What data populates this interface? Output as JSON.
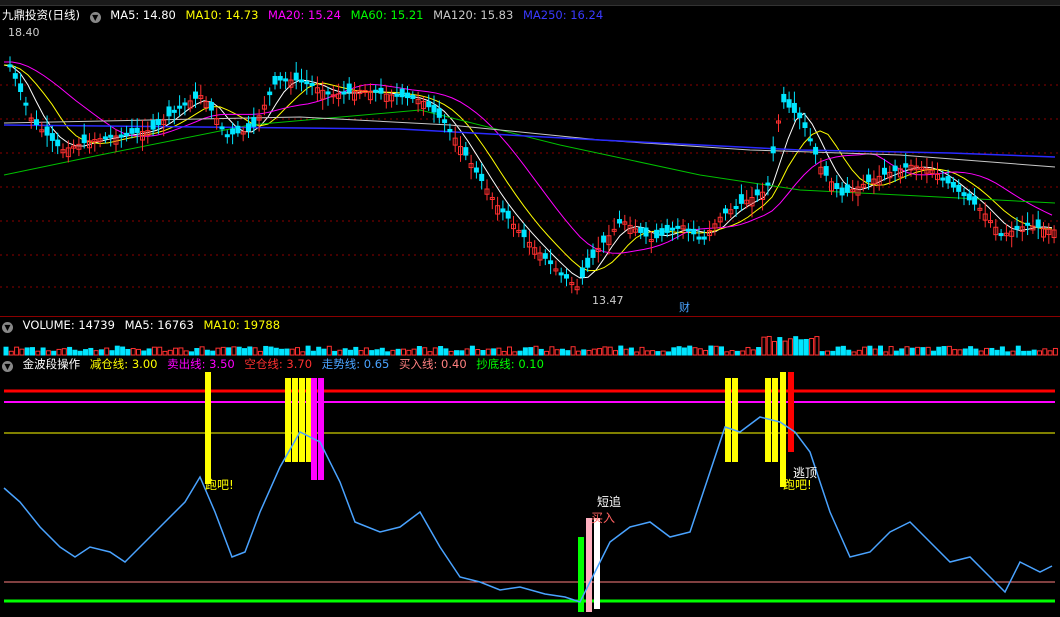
{
  "price_header": {
    "title": "九鼎投资(日线)",
    "ma": [
      {
        "label": "MA5: 14.80",
        "color": "#ffffff"
      },
      {
        "label": "MA10: 14.73",
        "color": "#ffff00"
      },
      {
        "label": "MA20: 15.24",
        "color": "#ff00ff"
      },
      {
        "label": "MA60: 15.21",
        "color": "#00ff00"
      },
      {
        "label": "MA120: 15.83",
        "color": "#c8c8c8"
      },
      {
        "label": "MA250: 16.24",
        "color": "#3a3aff"
      }
    ]
  },
  "price_annotations": {
    "high": "18.40",
    "low": "13.47",
    "event": "财"
  },
  "volume_header": {
    "items": [
      {
        "label": "VOLUME: 14739",
        "color": "#ffffff"
      },
      {
        "label": "MA5: 16763",
        "color": "#ffffff"
      },
      {
        "label": "MA10: 19788",
        "color": "#ffff00"
      }
    ]
  },
  "indicator_header": {
    "title": "金波段操作",
    "items": [
      {
        "label": "减仓线: 3.00",
        "color": "#ffff00"
      },
      {
        "label": "卖出线: 3.50",
        "color": "#ff00ff"
      },
      {
        "label": "空仓线: 3.70",
        "color": "#ff3030"
      },
      {
        "label": "走势线: 0.65",
        "color": "#4aa3ff"
      },
      {
        "label": "买入线: 0.40",
        "color": "#ff8080"
      },
      {
        "label": "抄底线: 0.10",
        "color": "#00ff00"
      }
    ]
  },
  "indicator_annotations": {
    "run1": "跑吧!",
    "run2": "跑吧!",
    "escape": "逃顶",
    "short_chase": "短追",
    "buy": "买入"
  },
  "colors": {
    "up": "#ff3030",
    "down": "#00ffff",
    "bg": "#000000",
    "grid": "#8b0000"
  }
}
